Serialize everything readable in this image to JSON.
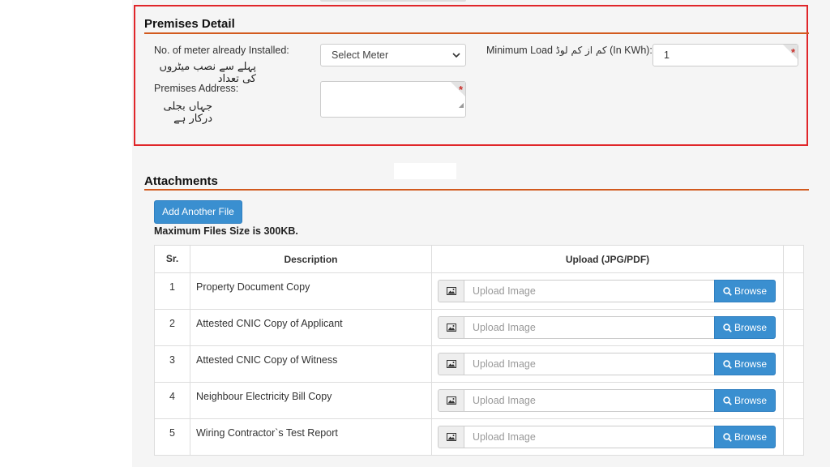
{
  "premises": {
    "title": "Premises Detail",
    "meter_label": "No. of meter already Installed:",
    "meter_label_urdu": "پہلے سے نصب میٹروں کی تعداد",
    "meter_select": "Select Meter",
    "load_label_prefix": "Minimum Load",
    "load_label_urdu": "کم از کم لوڈ",
    "load_label_suffix": "(In KWh):",
    "load_value": "1",
    "address_label": "Premises Address:",
    "address_label_urdu": "جہاں بجلی درکار ہے",
    "address_value": "",
    "required_mark": "*"
  },
  "attachments": {
    "title": "Attachments",
    "add_button": "Add Another File",
    "size_note": "Maximum Files Size is 300KB.",
    "headers": {
      "sr": "Sr.",
      "description": "Description",
      "upload": "Upload (JPG/PDF)"
    },
    "upload_placeholder": "Upload Image",
    "browse_label": "Browse",
    "rows": [
      {
        "sr": "1",
        "description": "Property Document Copy"
      },
      {
        "sr": "2",
        "description": "Attested CNIC Copy of Applicant"
      },
      {
        "sr": "3",
        "description": "Attested CNIC Copy of Witness"
      },
      {
        "sr": "4",
        "description": "Neighbour Electricity Bill Copy"
      },
      {
        "sr": "5",
        "description": "Wiring Contractor`s Test Report"
      }
    ]
  },
  "colors": {
    "highlight_border": "#e0262a",
    "section_rule": "#d25a1e",
    "primary_button": "#3a8fd0"
  },
  "icons": {
    "upload_addon": "image-icon",
    "browse": "search-icon",
    "select_arrow": "chevron-down-icon"
  }
}
